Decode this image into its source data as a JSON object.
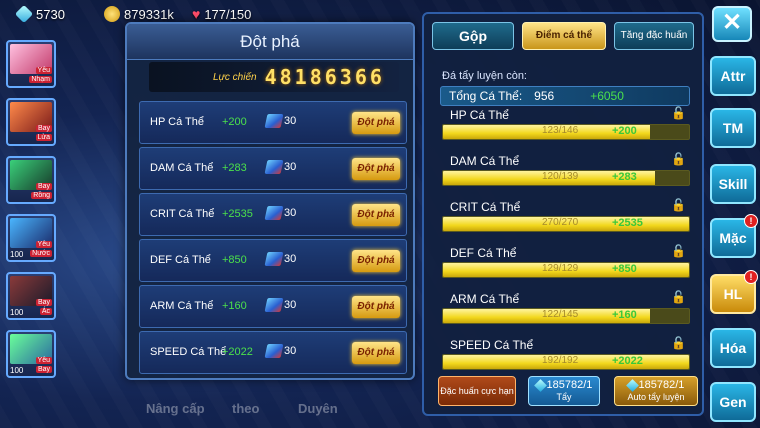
{
  "resources": {
    "gems": "5730",
    "gold": "879331k",
    "stamina": "177/150"
  },
  "party": [
    {
      "tags": [
        "Yêu",
        "Nhạm"
      ],
      "level": "",
      "colors": [
        "#ffc1e0",
        "#c23a6a"
      ]
    },
    {
      "tags": [
        "Bay",
        "Lửa"
      ],
      "level": "",
      "colors": [
        "#ff8a4a",
        "#7a1a1a"
      ]
    },
    {
      "tags": [
        "Bay",
        "Rồng"
      ],
      "level": "",
      "colors": [
        "#3ad07a",
        "#173a2a"
      ]
    },
    {
      "tags": [
        "Yêu",
        "Nước"
      ],
      "level": "100",
      "colors": [
        "#4ab6ff",
        "#1a2a6a"
      ]
    },
    {
      "tags": [
        "Bay",
        "Ác"
      ],
      "level": "100",
      "colors": [
        "#8a3a3a",
        "#1a1a2a"
      ]
    },
    {
      "tags": [
        "Yêu",
        "Bay"
      ],
      "level": "100",
      "colors": [
        "#6aff9a",
        "#2a6aa0"
      ]
    }
  ],
  "modal": {
    "title": "Đột phá",
    "power_label": "Lực chiến",
    "power_value": "48186366",
    "button_label": "Đột phá",
    "rows": [
      {
        "name": "HP Cá Thể",
        "bonus": "+200",
        "cost": "30"
      },
      {
        "name": "DAM Cá Thể",
        "bonus": "+283",
        "cost": "30"
      },
      {
        "name": "CRIT Cá Thể",
        "bonus": "+2535",
        "cost": "30"
      },
      {
        "name": "DEF Cá Thể",
        "bonus": "+850",
        "cost": "30"
      },
      {
        "name": "ARM Cá Thể",
        "bonus": "+160",
        "cost": "30"
      },
      {
        "name": "SPEED Cá Thể",
        "bonus": "+2022",
        "cost": "30"
      }
    ]
  },
  "panel": {
    "tabs": [
      "Gộp",
      "Điểm cá thể",
      "Tăng đặc huấn"
    ],
    "remaining_label": "Đá tẩy luyện còn:",
    "total_label": "Tổng Cá Thể:",
    "total_value": "956",
    "total_add": "+6050",
    "stats": [
      {
        "name": "HP Cá Thể",
        "value": "123/146",
        "add": "+200",
        "fill": 0.84
      },
      {
        "name": "DAM Cá Thể",
        "value": "120/139",
        "add": "+283",
        "fill": 0.86
      },
      {
        "name": "CRIT Cá Thể",
        "value": "270/270",
        "add": "+2535",
        "fill": 1.0
      },
      {
        "name": "DEF Cá Thể",
        "value": "129/129",
        "add": "+850",
        "fill": 1.0
      },
      {
        "name": "ARM Cá Thể",
        "value": "122/145",
        "add": "+160",
        "fill": 0.84
      },
      {
        "name": "SPEED Cá Thể",
        "value": "192/192",
        "add": "+2022",
        "fill": 1.0
      }
    ],
    "buttons": {
      "special": "Đặc huấn cực hạn",
      "wash_count": "185782/1",
      "wash_label": "Tẩy",
      "auto_count": "185782/1",
      "auto_label": "Auto tẩy luyện"
    }
  },
  "nav": {
    "close": "✕",
    "items": [
      "Attr",
      "TM",
      "Skill",
      "Mặc",
      "HL",
      "Hóa",
      "Gen"
    ]
  },
  "bottom_hints": [
    "Nâng cấp",
    "theo",
    "Duyên"
  ]
}
